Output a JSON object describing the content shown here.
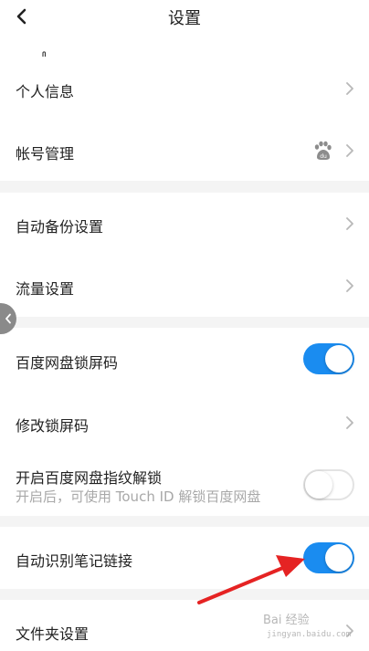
{
  "header": {
    "title": "设置",
    "back_icon": "chevron-left-icon"
  },
  "groups": [
    {
      "items": [
        {
          "label": "个人信息",
          "control": "chevron"
        },
        {
          "label": "帐号管理",
          "control": "chevron",
          "badge_icon": "baidu-paw-icon"
        }
      ]
    },
    {
      "items": [
        {
          "label": "自动备份设置",
          "control": "chevron"
        },
        {
          "label": "流量设置",
          "control": "chevron"
        }
      ]
    },
    {
      "items": [
        {
          "label": "百度网盘锁屏码",
          "control": "toggle",
          "toggle_on": true
        },
        {
          "label": "修改锁屏码",
          "control": "chevron"
        },
        {
          "label": "开启百度网盘指纹解锁",
          "sublabel": "开启后，可使用 Touch ID 解锁百度网盘",
          "control": "toggle",
          "toggle_on": false
        }
      ]
    },
    {
      "items": [
        {
          "label": "自动识别笔记链接",
          "control": "toggle",
          "toggle_on": true
        }
      ]
    },
    {
      "items": [
        {
          "label": "文件夹设置",
          "control": "chevron"
        }
      ]
    }
  ],
  "colors": {
    "accent": "#1a8cf0",
    "separator": "#f4f4f4",
    "text": "#222222",
    "subtext": "#a8a8a8",
    "annotation_arrow": "#e52323"
  },
  "watermark": {
    "text": "Bai 经验",
    "sub": "jingyan.baidu.com"
  }
}
